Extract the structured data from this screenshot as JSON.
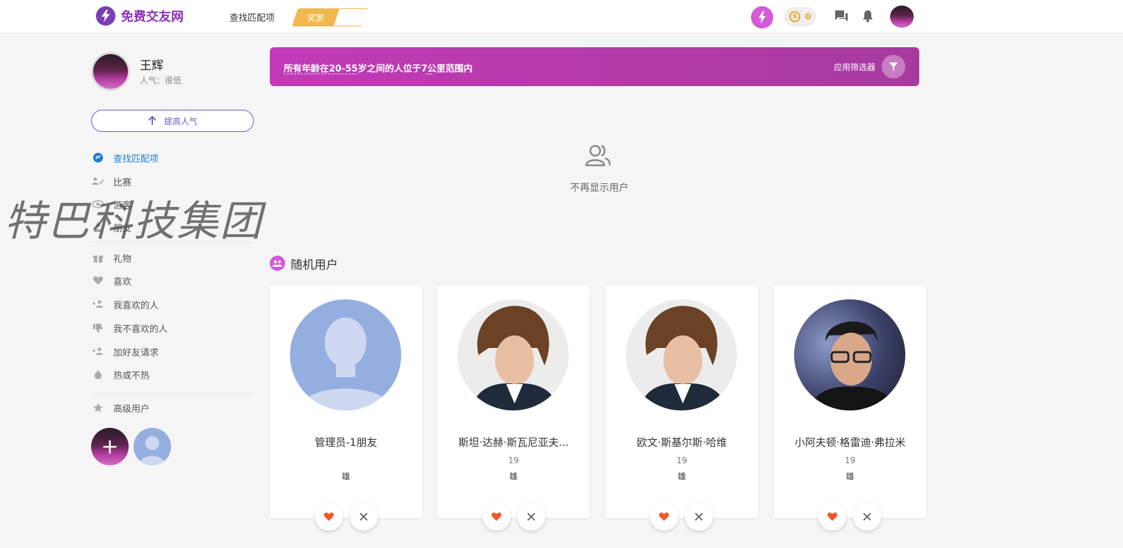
{
  "header": {
    "site_name": "免费交友网",
    "nav_find": "查找匹配项",
    "nav_award": "奖赏",
    "credits": "0"
  },
  "profile": {
    "name": "王辉",
    "popularity": "人气：很低",
    "boost_label": "提高人气"
  },
  "menu": {
    "items": [
      {
        "label": "查找匹配项",
        "icon": "find-matches-icon"
      },
      {
        "label": "比赛",
        "icon": "match-icon"
      },
      {
        "label": "游客",
        "icon": "visitors-icon"
      },
      {
        "label": "朋友",
        "icon": "friends-icon"
      },
      {
        "label": "礼物",
        "icon": "gift-icon"
      },
      {
        "label": "喜欢",
        "icon": "heart-icon"
      },
      {
        "label": "我喜欢的人",
        "icon": "people-liked-icon"
      },
      {
        "label": "我不喜欢的人",
        "icon": "thumb-down-icon"
      },
      {
        "label": "加好友请求",
        "icon": "add-friend-icon"
      },
      {
        "label": "热或不热",
        "icon": "fire-icon"
      },
      {
        "label": "高级用户",
        "icon": "star-icon"
      }
    ]
  },
  "watermark": "特巴科技集团",
  "filter": {
    "text": "所有年龄在20-55岁之间的人位于7公里范围内",
    "apply_label": "应用筛选器"
  },
  "empty_text": "不再显示用户",
  "random_title": "随机用户",
  "cards": [
    {
      "name": "管理员-1朋友",
      "age": "",
      "gender": "雄"
    },
    {
      "name": "斯坦·达赫·斯瓦尼亚夫...",
      "age": "19",
      "gender": "雄"
    },
    {
      "name": "欧文·斯基尔斯·哈维",
      "age": "19",
      "gender": "雄"
    },
    {
      "name": "小阿夫顿·格雷迪·弗拉米",
      "age": "19",
      "gender": "雄"
    }
  ],
  "colors": {
    "brand": "#8e2fb8",
    "accent_pink": "#d45ad8",
    "link_blue": "#1a7fd6",
    "like_red": "#f05a28"
  }
}
